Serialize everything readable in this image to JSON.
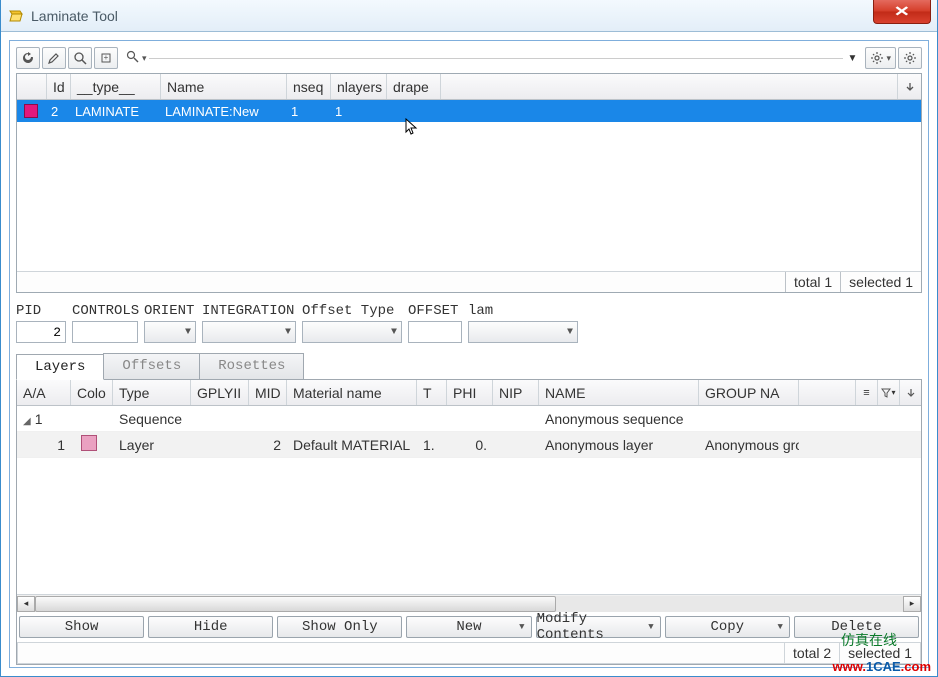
{
  "title": "Laminate Tool",
  "upper_table": {
    "columns": [
      "Id",
      "__type__",
      "Name",
      "nseq",
      "nlayers",
      "drape"
    ],
    "rows": [
      {
        "id": "2",
        "type": "LAMINATE",
        "name": "LAMINATE:New",
        "nseq": "1",
        "nlayers": "1",
        "drape": ""
      }
    ],
    "status_total": "total 1",
    "status_selected": "selected 1"
  },
  "form": {
    "pid_label": "PID",
    "pid_value": "2",
    "controls_label": "CONTROLS",
    "controls_value": "",
    "orient_label": "ORIENT",
    "orient_value": "",
    "integration_label": "INTEGRATION",
    "integration_value": "",
    "offset_type_label": "Offset Type",
    "offset_type_value": "",
    "offset_label": "OFFSET",
    "offset_value": "",
    "lam_label": "lam",
    "lam_value": ""
  },
  "tabs": {
    "layers": "Layers",
    "offsets": "Offsets",
    "rosettes": "Rosettes"
  },
  "lower_table": {
    "columns": {
      "aa": "A/A",
      "colo": "Colo",
      "type": "Type",
      "gply": "GPLYII",
      "mid": "MID",
      "matn": "Material name",
      "t": "T",
      "phi": "PHI",
      "nip": "NIP",
      "name": "NAME",
      "group": "GROUP NA"
    },
    "rows": [
      {
        "aa": "1",
        "level": 0,
        "colo": "",
        "type": "Sequence",
        "gply": "",
        "mid": "",
        "matn": "",
        "t": "",
        "phi": "",
        "nip": "",
        "name": "Anonymous sequence",
        "group": ""
      },
      {
        "aa": "1",
        "level": 1,
        "colo": "sw",
        "type": "Layer",
        "gply": "",
        "mid": "2",
        "matn": "Default MATERIAL",
        "t": "1.",
        "phi": "0.",
        "nip": "",
        "name": "Anonymous layer",
        "group": "Anonymous group"
      }
    ]
  },
  "buttons": {
    "show": "Show",
    "hide": "Hide",
    "show_only": "Show Only",
    "new": "New",
    "modify": "Modify Contents",
    "copy": "Copy",
    "delete": "Delete"
  },
  "status2_total": "total 2",
  "status2_sel": "selected 1",
  "watermark_top": "仿真在线",
  "watermark": "www.1CAE.com"
}
